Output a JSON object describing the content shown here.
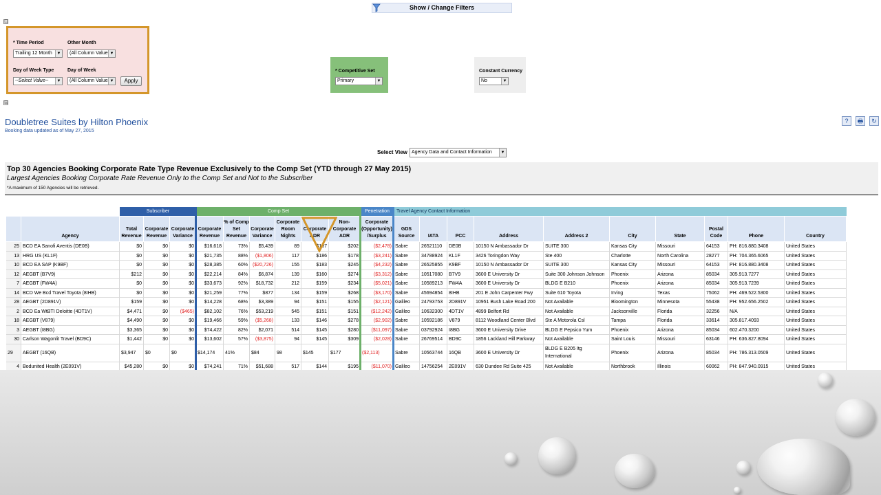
{
  "filters_bar": {
    "label": "Show / Change Filters"
  },
  "expand_toggle_top": "⊟",
  "expand_toggle_bottom": "⊞",
  "filters": {
    "time_period_label": "* Time Period",
    "time_period_value": "Trailing 12 Month",
    "other_month_label": "Other Month",
    "other_month_value": "(All Column Values)",
    "dow_type_label": "Day of Week Type",
    "dow_type_value": "--Select Value--",
    "dow_label": "Day of Week",
    "dow_value": "(All Column Values)",
    "apply_label": "Apply",
    "comp_set_label": "* Competitive Set",
    "comp_set_value": "Primary",
    "currency_label": "Constant Currency",
    "currency_value": "No"
  },
  "header": {
    "hotel_name": "Doubletree Suites by Hilton Phoenix",
    "booking_update": "Booking data updated as of May 27, 2015"
  },
  "toolbar": {
    "help": "?",
    "print": "🖶",
    "refresh": "↻"
  },
  "view": {
    "label": "Select View",
    "value": "Agency Data and Contact Information"
  },
  "report": {
    "title": "Top 30 Agencies Booking Corporate Rate Type Revenue Exclusively to the Comp Set (YTD through 27 May 2015)",
    "subtitle": "Largest Agencies Booking Corporate Rate Revenue Only to the Comp Set and Not to the Subscriber",
    "note": "*A maximum of 150 Agencies will be retrieved."
  },
  "table": {
    "groups": [
      {
        "label": "Subscriber",
        "color": "#2f5fa8"
      },
      {
        "label": "Comp Set",
        "color": "#6db06a"
      },
      {
        "label": "Penetration",
        "color": "#4a86c8"
      },
      {
        "label": "Travel Agency Contact Information",
        "color": "#8fcbd9"
      }
    ],
    "columns": [
      "",
      "Agency",
      "Total Revenue",
      "Corporate Revenue",
      "Corporate Variance",
      "Corporate Revenue",
      "% of Comp Set Revenue",
      "Corporate Variance",
      "Corporate Room Nights",
      "Corporate ADR",
      "Non-Corporate ADR",
      "Corporate (Opportunity) /Surplus",
      "GDS Source",
      "IATA",
      "PCC",
      "Address",
      "Address 2",
      "City",
      "State",
      "Postal Code",
      "Phone",
      "Country"
    ],
    "rows": [
      [
        "25",
        "BCD EA Sanofi Aventis (DE0B)",
        "$0",
        "$0",
        "$0",
        "$16,618",
        "73%",
        "$5,439",
        "89",
        "$187",
        "$202",
        "($2,478)",
        "Sabre",
        "26521110",
        "DE0B",
        "10150 N Ambassador Dr",
        "SUITE 300",
        "Kansas City",
        "Missouri",
        "64153",
        "PH: 816.880.3408",
        "United States"
      ],
      [
        "13",
        "HRG US (KL1F)",
        "$0",
        "$0",
        "$0",
        "$21,735",
        "88%",
        "($1,806)",
        "117",
        "$186",
        "$178",
        "($3,241)",
        "Sabre",
        "34788924",
        "KL1F",
        "3426 Toringdon Way",
        "Ste 400",
        "Charlotte",
        "North Carolina",
        "28277",
        "PH: 704.365.6065",
        "United States"
      ],
      [
        "10",
        "BCD EA SAP (K9BF)",
        "$0",
        "$0",
        "$0",
        "$28,385",
        "60%",
        "($20,726)",
        "155",
        "$183",
        "$245",
        "($4,232)",
        "Sabre",
        "26525855",
        "K9BF",
        "10150 N Ambassador Dr",
        "SUITE 300",
        "Kansas City",
        "Missouri",
        "64153",
        "PH: 816.880.3408",
        "United States"
      ],
      [
        "12",
        "AEGBT (B7V9)",
        "$212",
        "$0",
        "$0",
        "$22,214",
        "84%",
        "$6,874",
        "139",
        "$160",
        "$274",
        "($3,312)",
        "Sabre",
        "10517080",
        "B7V9",
        "3600 E University Dr",
        "Suite 300 Johnson Johnson",
        "Phoenix",
        "Arizona",
        "85034",
        "305.913.7277",
        "United States"
      ],
      [
        "7",
        "AEGBT (FW4A)",
        "$0",
        "$0",
        "$0",
        "$33,673",
        "92%",
        "$18,732",
        "212",
        "$159",
        "$234",
        "($5,021)",
        "Sabre",
        "10589213",
        "FW4A",
        "3600 E University Dr",
        "BLDG E B210",
        "Phoenix",
        "Arizona",
        "85034",
        "305.913.7239",
        "United States"
      ],
      [
        "14",
        "BCD We Bcd Travel Toyota (8IHB)",
        "$0",
        "$0",
        "$0",
        "$21,259",
        "77%",
        "$877",
        "134",
        "$159",
        "$268",
        "($3,170)",
        "Sabre",
        "45694854",
        "8IHB",
        "201 E John Carpenter Fwy",
        "Suite 610 Toyota",
        "Irving",
        "Texas",
        "75062",
        "PH: 469.522.5300",
        "United States"
      ],
      [
        "28",
        "AEGBT (2D891V)",
        "$159",
        "$0",
        "$0",
        "$14,228",
        "68%",
        "$3,389",
        "94",
        "$151",
        "$155",
        "($2,121)",
        "Galileo",
        "24793753",
        "2D891V",
        "10951 Bush Lake Road 200",
        "Not Available",
        "Bloomington",
        "Minnesota",
        "55438",
        "PH: 952.656.2502",
        "United States"
      ],
      [
        "2",
        "BCD Ea WtBTI Deloitte (4DT1V)",
        "$4,471",
        "$0",
        "($465)",
        "$82,102",
        "76%",
        "$53,219",
        "545",
        "$151",
        "$151",
        "($12,242)",
        "Galileo",
        "10632300",
        "4DT1V",
        "4899 Belfort Rd",
        "Not Available",
        "Jacksonville",
        "Florida",
        "32256",
        "N/A",
        "United States"
      ],
      [
        "18",
        "AEGBT (V879)",
        "$4,490",
        "$0",
        "$0",
        "$19,466",
        "59%",
        "($5,268)",
        "133",
        "$146",
        "$278",
        "($2,902)",
        "Sabre",
        "10592186",
        "V879",
        "8112 Woodland Center Blvd",
        "Ste A Motorola Csl",
        "Tampa",
        "Florida",
        "33614",
        "305.817.4093",
        "United States"
      ],
      [
        "3",
        "AEGBT (I8BG)",
        "$3,365",
        "$0",
        "$0",
        "$74,422",
        "82%",
        "$2,071",
        "514",
        "$145",
        "$280",
        "($11,097)",
        "Sabre",
        "03792924",
        "I8BG",
        "3600 E University Drive",
        "BLDG E Pepsico Yum",
        "Phoenix",
        "Arizona",
        "85034",
        "602.470.3200",
        "United States"
      ],
      [
        "30",
        "Carlson Wagonlit Travel (BD9C)",
        "$1,442",
        "$0",
        "$0",
        "$13,602",
        "57%",
        "($3,875)",
        "94",
        "$145",
        "$309",
        "($2,028)",
        "Sabre",
        "26769514",
        "BD9C",
        "1856 Lackland Hill Parkway",
        "Not Available",
        "Saint Louis",
        "Missouri",
        "63146",
        "PH: 636.827.8094",
        "United States"
      ],
      [
        "29",
        "AEGBT (16QB)",
        "$3,947",
        "$0",
        "$0",
        "$14,174",
        "41%",
        "$84",
        "98",
        "$145",
        "$177",
        "($2,113)",
        "Sabre",
        "10563744",
        "16QB",
        "3600 E University Dr",
        "BLDG E B205 Itg International",
        "Phoenix",
        "Arizona",
        "85034",
        "PH: 786.313.0509",
        "United States"
      ],
      [
        "4",
        "Bodunited Health (2E091V)",
        "$45,280",
        "$0",
        "$0",
        "$74,241",
        "71%",
        "$51,688",
        "517",
        "$144",
        "$195",
        "($11,070)",
        "Galileo",
        "14756254",
        "2E091V",
        "630 Dundee Rd Suite 425",
        "Not Available",
        "Northbrook",
        "Illinois",
        "60062",
        "PH: 847.940.0915",
        "United States"
      ]
    ]
  },
  "colors": {
    "accent_blue": "#1f4e9c",
    "negative_red": "#e02020",
    "highlight_orange": "#d4962a"
  }
}
